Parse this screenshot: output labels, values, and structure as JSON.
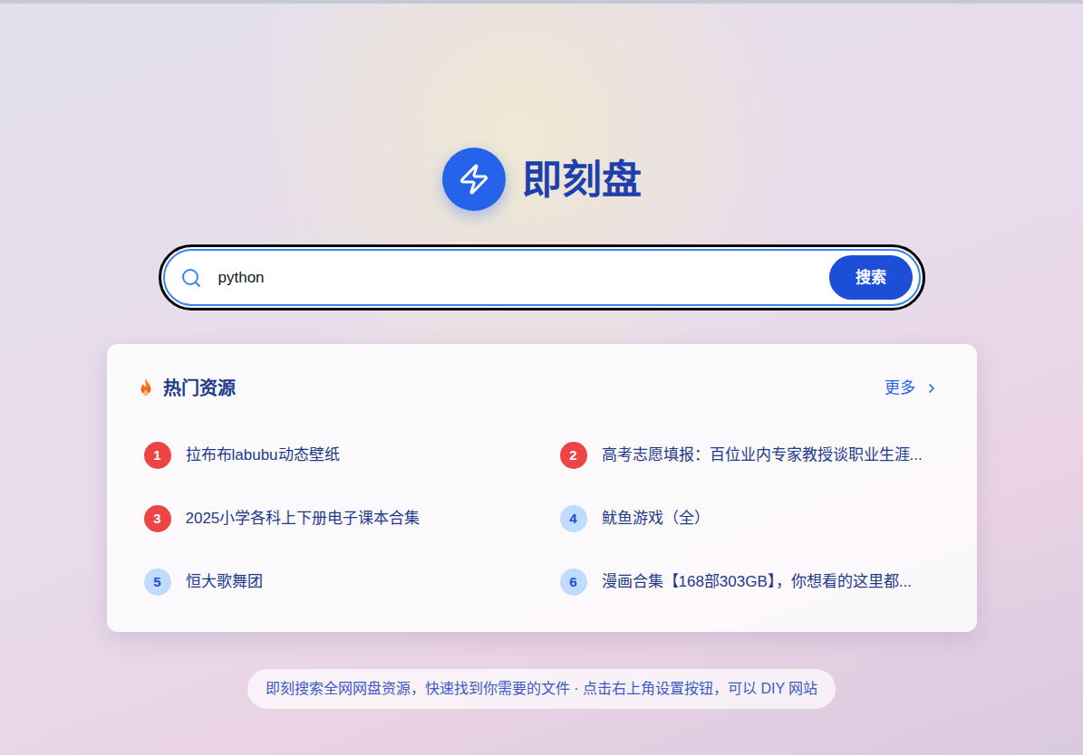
{
  "logo": {
    "title": "即刻盘"
  },
  "search": {
    "value": "python",
    "button": "搜索"
  },
  "hot": {
    "title": "热门资源",
    "more": "更多",
    "items": [
      {
        "rank": "1",
        "title": "拉布布labubu动态壁纸",
        "top": true
      },
      {
        "rank": "2",
        "title": "高考志愿填报：百位业内专家教授谈职业生涯...",
        "top": true
      },
      {
        "rank": "3",
        "title": "2025小学各科上下册电子课本合集",
        "top": true
      },
      {
        "rank": "4",
        "title": "鱿鱼游戏（全）",
        "top": false
      },
      {
        "rank": "5",
        "title": "恒大歌舞团",
        "top": false
      },
      {
        "rank": "6",
        "title": "漫画合集【168部303GB】，你想看的这里都...",
        "top": false
      }
    ]
  },
  "footer": "即刻搜索全网网盘资源，快速找到你需要的文件 · 点击右上角设置按钮，可以 DIY 网站"
}
